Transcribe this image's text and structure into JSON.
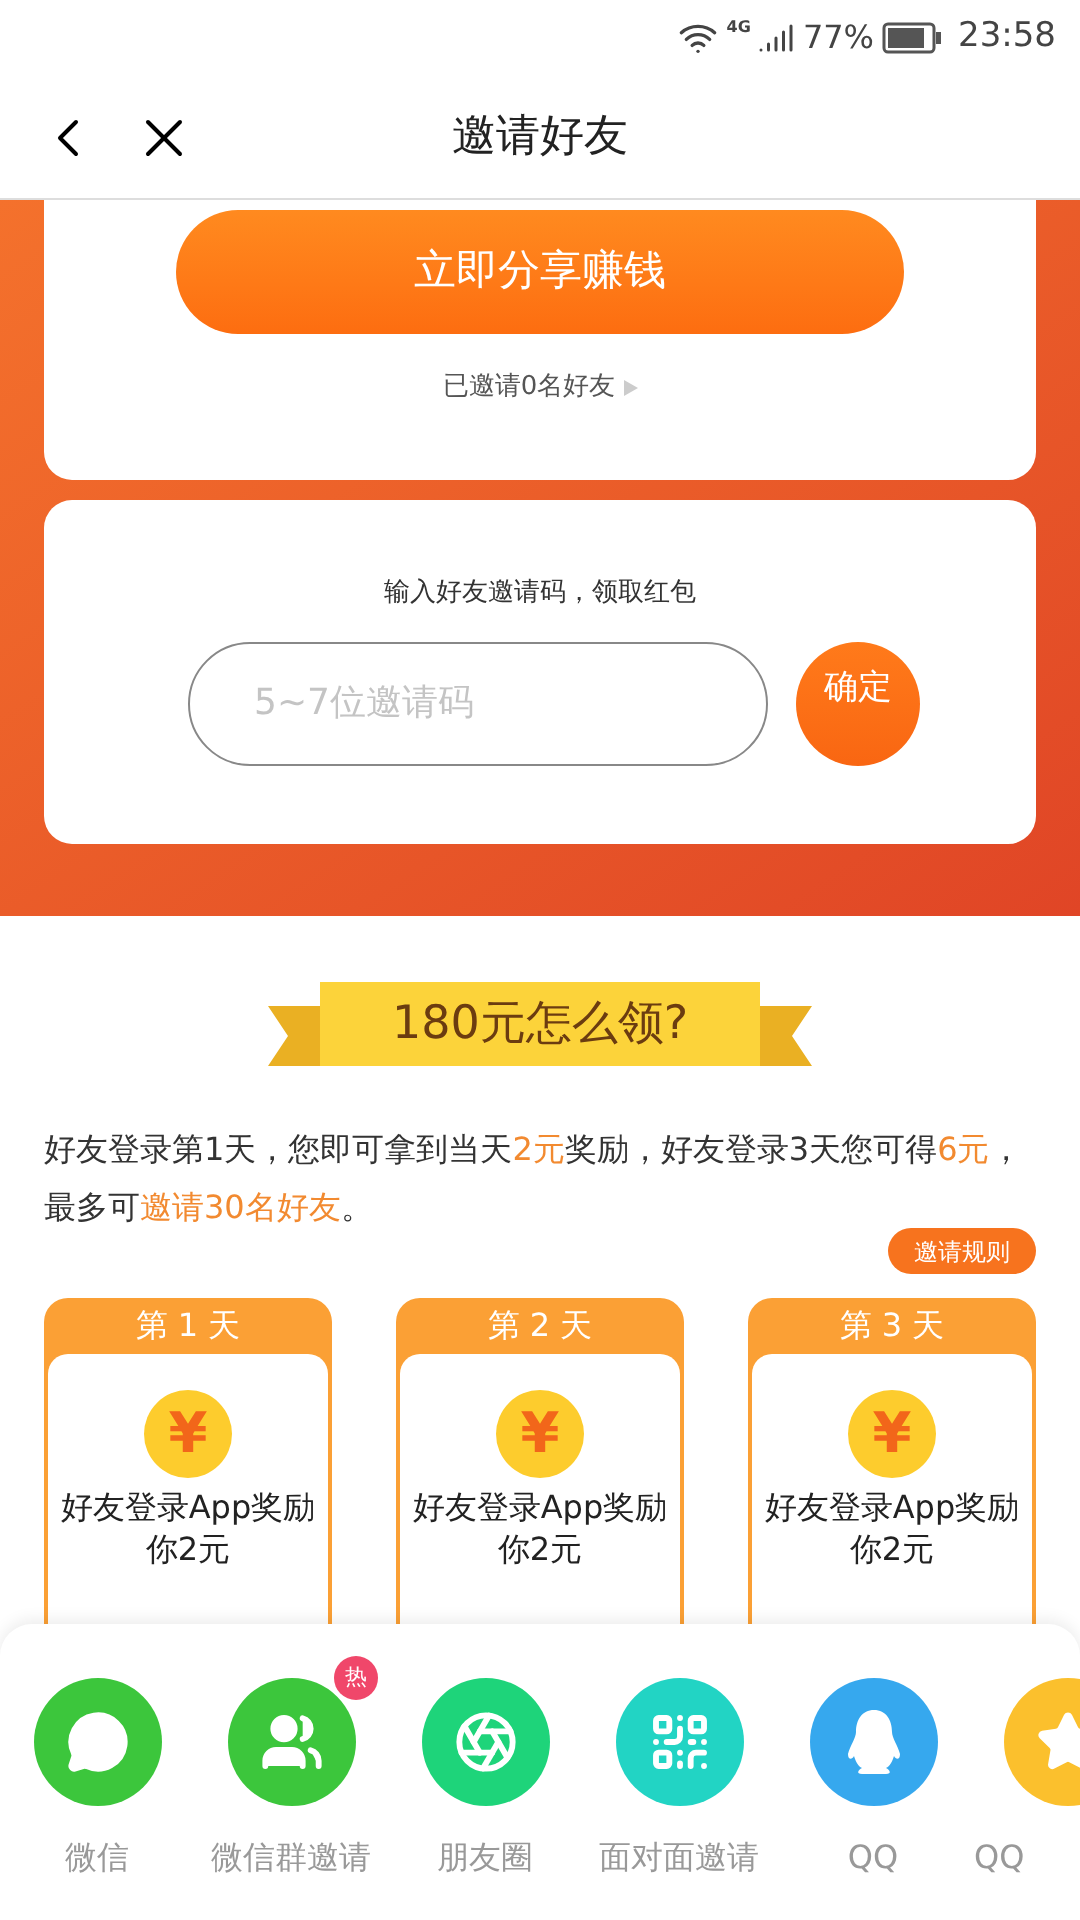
{
  "status_bar": {
    "network": "4G",
    "battery": "77%",
    "time": "23:58"
  },
  "header": {
    "title": "邀请好友"
  },
  "share_card": {
    "button": "立即分享赚钱",
    "invited": "已邀请0名好友"
  },
  "code_card": {
    "prompt": "输入好友邀请码，领取红包",
    "placeholder": "5~7位邀请码",
    "confirm": "确定"
  },
  "banner": {
    "title": "180元怎么领?"
  },
  "description": "好友登录第1天，您即可拿到当天**2元**奖励，好友登录3天您可得**6元**，最多可**邀请30名好友**。",
  "rules_button": "邀请规则",
  "days": [
    {
      "header": "第 1 天",
      "symbol": "¥",
      "text": "好友登录App奖励你2元"
    },
    {
      "header": "第 2 天",
      "symbol": "¥",
      "text": "好友登录App奖励你2元"
    },
    {
      "header": "第 3 天",
      "symbol": "¥",
      "text": "好友登录App奖励你2元"
    }
  ],
  "share_targets": [
    {
      "kind": "chat",
      "label": "微信",
      "color": "#3cc63c"
    },
    {
      "kind": "group",
      "label": "微信群邀请",
      "color": "#3cc63c",
      "badge": "热"
    },
    {
      "kind": "moments",
      "label": "朋友圈",
      "color": "#1ed47a"
    },
    {
      "kind": "qrcode",
      "label": "面对面邀请",
      "color": "#22d4c4"
    },
    {
      "kind": "penguin",
      "label": "QQ",
      "color": "#36a8ee"
    },
    {
      "kind": "star",
      "label": "QQ",
      "color": "#fbc02d"
    }
  ]
}
